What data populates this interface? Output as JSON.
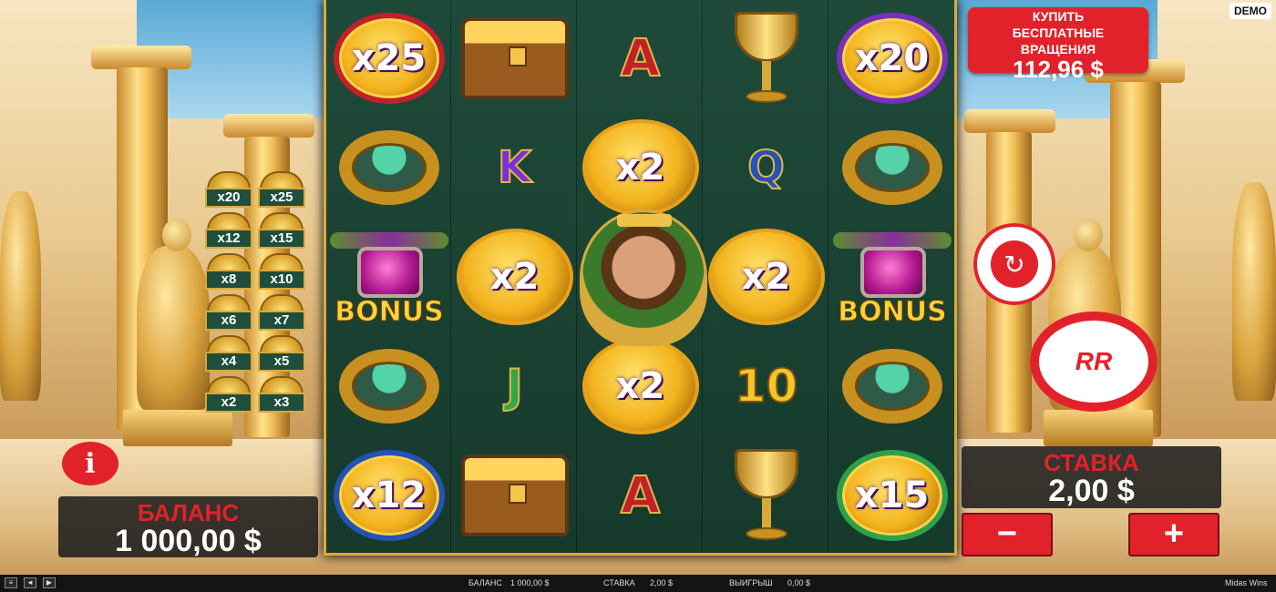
{
  "game": {
    "title": "Midas Wins",
    "demo_badge": "DEMO"
  },
  "buy_feature": {
    "line1": "КУПИТЬ",
    "line2": "БЕСПЛАТНЫЕ",
    "line3": "ВРАЩЕНИЯ",
    "price": "112,96 $"
  },
  "balance": {
    "label": "БАЛАНС",
    "value": "1 000,00 $"
  },
  "bet": {
    "label": "СТАВКА",
    "value": "2,00 $",
    "minus": "−",
    "plus": "+"
  },
  "buttons": {
    "info": "i",
    "spin": "RR",
    "autoplay": "↻"
  },
  "multiplier_ladder": [
    [
      "x20",
      "x25"
    ],
    [
      "x12",
      "x15"
    ],
    [
      "x8",
      "x10"
    ],
    [
      "x6",
      "x7"
    ],
    [
      "x4",
      "x5"
    ],
    [
      "x2",
      "x3"
    ]
  ],
  "reels": [
    [
      "x25",
      "ring",
      "bonus",
      "ring",
      "x12"
    ],
    [
      "chest",
      "K",
      "x2",
      "J",
      "chest"
    ],
    [
      "A",
      "x2",
      "midas",
      "x2",
      "A"
    ],
    [
      "goblet",
      "Q",
      "x2",
      "10",
      "goblet"
    ],
    [
      "x20",
      "ring",
      "bonus",
      "ring",
      "x15"
    ]
  ],
  "symbol_text": {
    "r0_0": "x25",
    "r0_4": "x12",
    "r1_1": "K",
    "r1_2": "x2",
    "r1_3": "J",
    "r2_0": "A",
    "r2_1": "x2",
    "r2_3": "x2",
    "r2_4": "A",
    "r3_1": "Q",
    "r3_2": "x2",
    "r3_3": "10",
    "r4_0": "x20",
    "r4_4": "x15",
    "bonus": "BONUS"
  },
  "status_bar": {
    "balance_label": "БАЛАНС",
    "balance_value": "1 000,00 $",
    "bet_label": "СТАВКА",
    "bet_value": "2,00 $",
    "win_label": "ВЫИГРЫШ",
    "win_value": "0,00 $",
    "game_name": "Midas Wins"
  },
  "colors": {
    "accent_red": "#e2222a",
    "reel_green": "#1f4a3a",
    "gold": "#d9a93c"
  }
}
